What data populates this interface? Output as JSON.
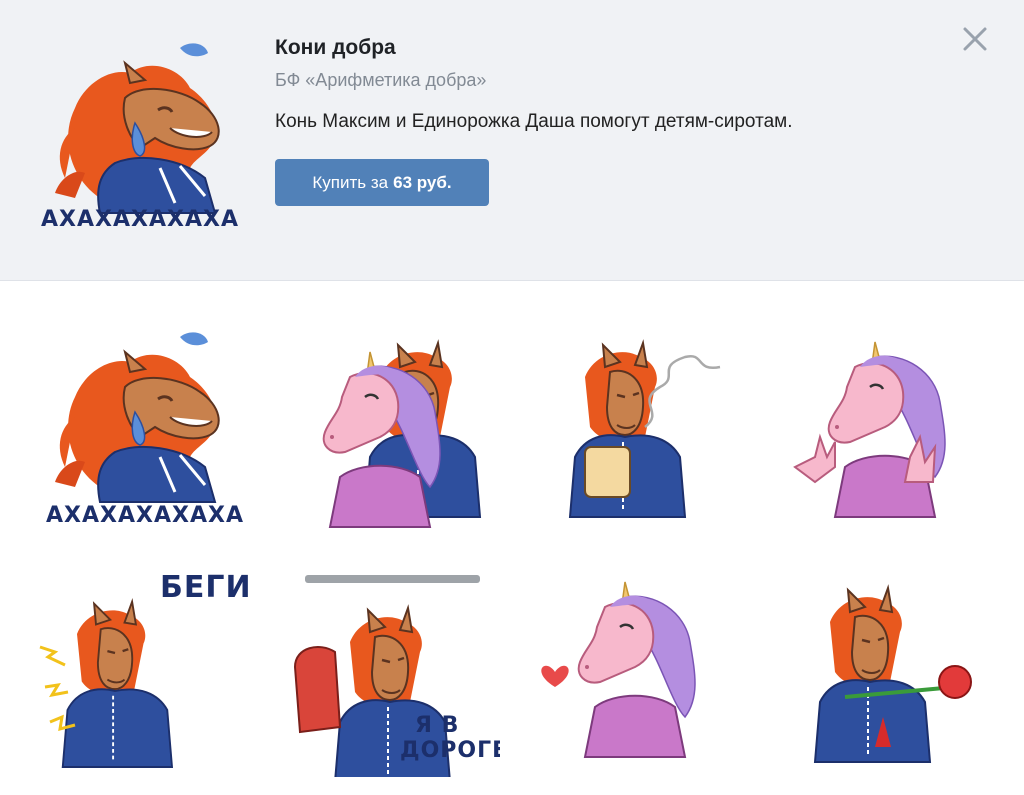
{
  "pack": {
    "title": "Кони добра",
    "author": "БФ «Арифметика добра»",
    "description": "Конь Максим и Единорожка Даша помогут детям-сиротам.",
    "buy_prefix": "Купить за",
    "price": "63 руб."
  },
  "colors": {
    "header_bg": "#f0f2f5",
    "button": "#5181b8",
    "mane": "#e8581e",
    "horse": "#c8814d",
    "unicorn": "#f7b8cc",
    "unicorn_mane": "#b48ee0",
    "hoodie": "#2e4f9e",
    "caption": "#1c2f6b"
  },
  "stickers": [
    {
      "icon": "laughing-horse-sticker",
      "caption": "АХАХАХАХАХА"
    },
    {
      "icon": "hugging-unicorn-horse-sticker",
      "caption": ""
    },
    {
      "icon": "coffee-horse-sticker",
      "caption": ""
    },
    {
      "icon": "surprised-unicorn-sticker",
      "caption": ""
    },
    {
      "icon": "running-horse-sticker",
      "caption": "БЕГИ"
    },
    {
      "icon": "commuting-horse-sticker",
      "caption_line1": "Я В",
      "caption_line2": "ДОРОГЕ"
    },
    {
      "icon": "loving-unicorn-sticker",
      "caption": ""
    },
    {
      "icon": "rose-horse-sticker",
      "caption": ""
    }
  ],
  "cover": {
    "icon": "laughing-horse-cover",
    "caption": "АХАХАХАХАХА"
  }
}
